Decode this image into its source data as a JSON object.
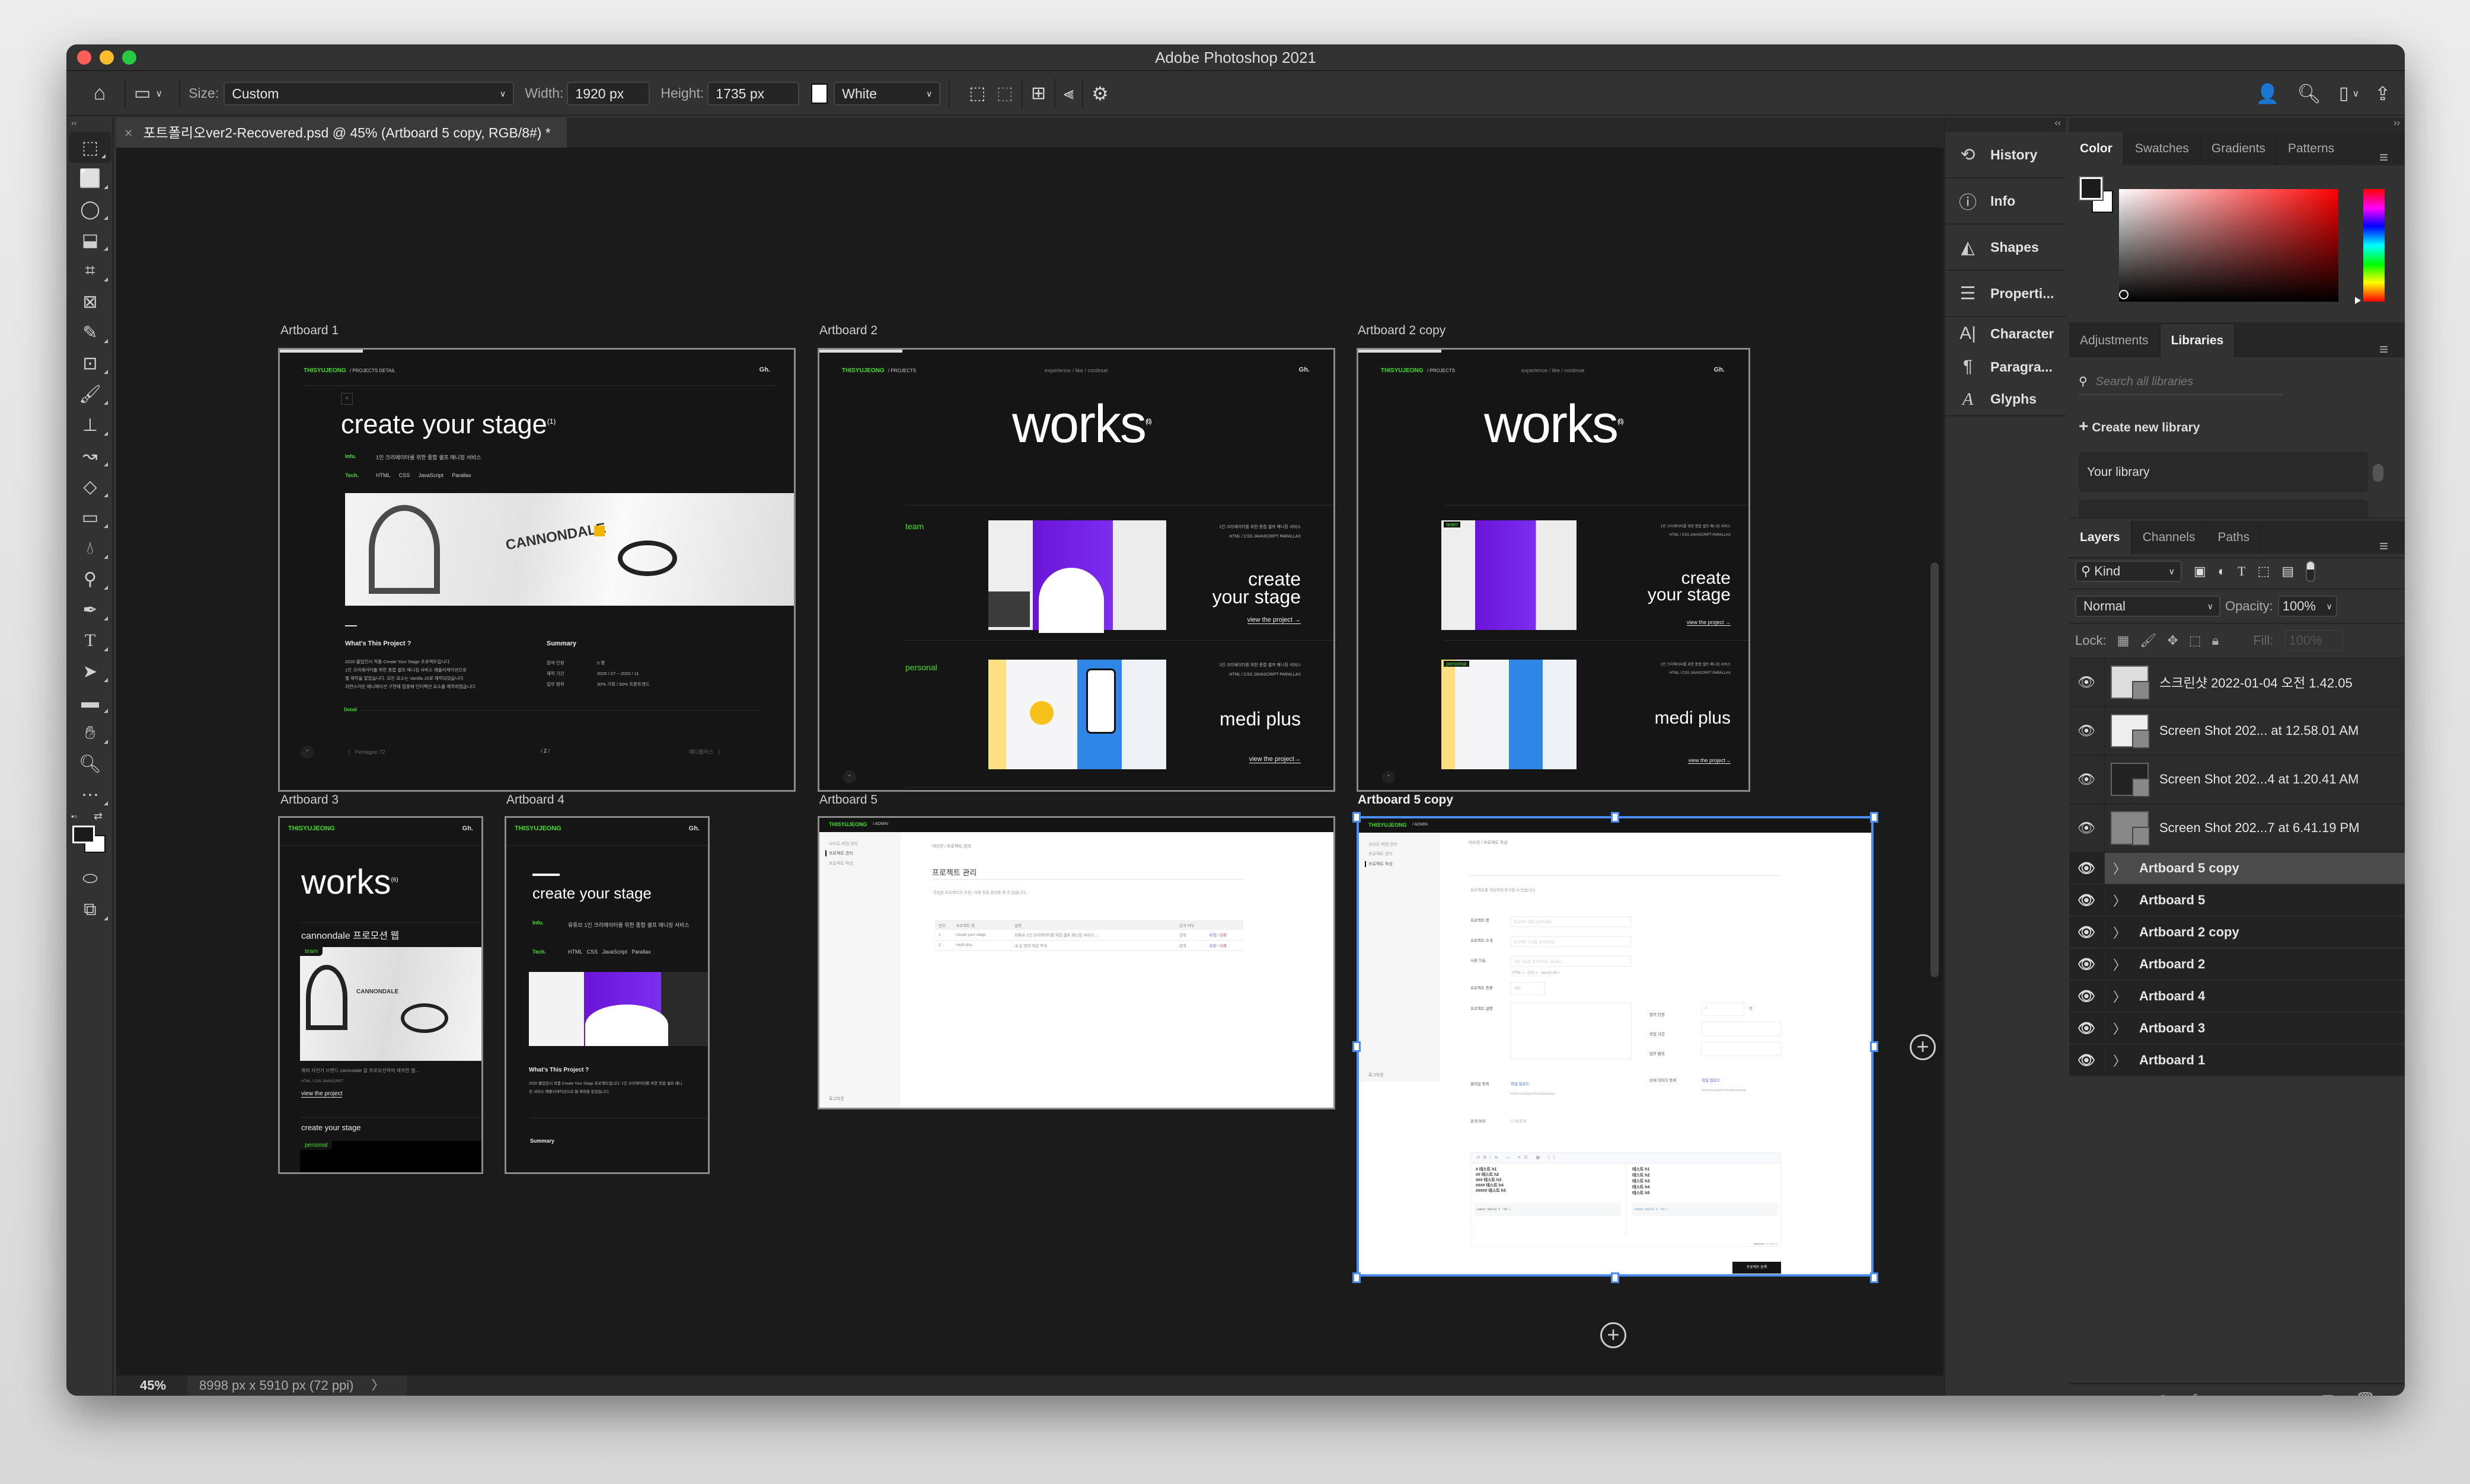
{
  "window": {
    "title": "Adobe Photoshop 2021"
  },
  "options_bar": {
    "size_label": "Size:",
    "size_value": "Custom",
    "width_label": "Width:",
    "width_value": "1920 px",
    "height_label": "Height:",
    "height_value": "1735 px",
    "bg_value": "White"
  },
  "document_tab": {
    "title": "포트폴리오ver2-Recovered.psd @ 45% (Artboard 5 copy, RGB/8#) *"
  },
  "status_bar": {
    "zoom": "45%",
    "doc_info": "8998 px x 5910 px (72 ppi)"
  },
  "tools": [
    "artboard",
    "rectangular-marquee",
    "lasso",
    "object-selection",
    "crop",
    "frame",
    "eyedropper",
    "spot-healing",
    "brush",
    "clone-stamp",
    "history-brush",
    "eraser",
    "gradient",
    "blur",
    "dodge",
    "pen",
    "type",
    "path-selection",
    "rectangle",
    "hand",
    "zoom",
    "more"
  ],
  "artboards": {
    "ab1": {
      "label": "Artboard 1",
      "brand": "THISYUJEONG",
      "crumb": "/  PROJECTS DETAIL",
      "gh": "Gh.",
      "title": "create your stage",
      "title_sup": "(1)",
      "info_label": "Info.",
      "info_text": "1인 크리에이터를 위한 종합 셀프 매니징 서비스",
      "tech_label": "Tech.",
      "tech": [
        "HTML",
        "CSS",
        "JavaScript",
        "Parallax"
      ],
      "what_title": "What's This Project ?",
      "what_lines": [
        "2020 졸업전시 작품 Create Your Stage 프로젝트입니다.",
        "1인 크리에이터를 위한 종합 셀프 매니징 서비스 애플리케이션으로",
        "웹 제작을 맡았습니다. 모든 요소는 Vanilla JS로 제작되었습니다.",
        "자연스러운 애니메이션 구현에 집중해 인터랙션 요소를 제작하였습니다."
      ],
      "summary_title": "Summary",
      "summary": [
        {
          "k": "참여 인원",
          "v": "5 명"
        },
        {
          "k": "제작 기간",
          "v": "2020 / 07 ~ 2020 / 11"
        },
        {
          "k": "업무 범위",
          "v": "30% 기획 / 50% 프론트엔드"
        }
      ],
      "detail": "Detail",
      "prev": "Pentagon 72",
      "page": "2",
      "next": "메디플러스"
    },
    "ab2": {
      "label": "Artboard 2",
      "brand": "THISYUJEONG",
      "crumb": "/  PROJECTS",
      "nav": "experience / like / continue",
      "gh": "Gh.",
      "title": "works",
      "title_sup": "(6)",
      "projects": [
        {
          "tag": "team",
          "desc": "1인 크리에이터를 위한 종합 셀프 매니징 서비스",
          "tech": "HTML / CSS   JAVASCRIPT   PARALLAX",
          "name1": "create",
          "name2": "your stage",
          "link": "view the project →"
        },
        {
          "tag": "personal",
          "desc": "1인 크리에이터를 위한 종합 셀프 매니징 서비스",
          "tech": "HTML / CSS   JAVASCRIPT   PARALLAX",
          "name1": "medi plus",
          "name2": "",
          "link": "view the project→"
        }
      ]
    },
    "ab2copy": {
      "label": "Artboard 2 copy"
    },
    "ab3": {
      "label": "Artboard 3",
      "brand": "THISYUJEONG",
      "gh": "Gh.",
      "title": "works",
      "title_sup": "(6)",
      "project1": "cannondale 프로모션 웹",
      "tag1": "team",
      "desc1": "해외 자전거 브랜드 cannodale 을 프로모션하여 제작한 웹...",
      "tech1": "HTML / CSS   JAVASCRIPT",
      "link1": "view the project",
      "project2": "create your stage",
      "tag2": "personal"
    },
    "ab4": {
      "label": "Artboard 4",
      "brand": "THISYUJEONG",
      "gh": "Gh.",
      "title": "create your stage",
      "info_label": "Info.",
      "info_text": "유튜브 1인 크리에이터를 위한 종합 셀프 매니징 서비스",
      "tech_label": "Tech.",
      "tech": "HTML   CSS   JavaScript   Parallax",
      "what_title": "What's This Project ?",
      "what_text": "2020 졸업전시 작품 Create Your Stage 프로젝트입니다. 1인 크리에이터를 위한 종합 셀프 매니징 서비스 애플리케이션으로 웹 제작을 맡았습니다.",
      "summary_title": "Summary"
    },
    "ab5": {
      "label": "Artboard 5",
      "brand": "THISYUJEONG",
      "crumb": "/  ADMIN",
      "menu": [
        "사이트 버전 관리",
        "프로젝트 관리",
        "프로젝트 작성"
      ],
      "breadcrumb": "어드민 / 프로젝트 관리",
      "heading": "프로젝트 관리",
      "desc": "작성된 프로젝트의 수정 / 삭제 등을 관리를 할 수 있습니다.",
      "table_headers": [
        "번호",
        "프로젝트 명",
        "설명",
        "공개 여부",
        ""
      ],
      "rows": [
        {
          "no": "1",
          "name": "create your stage",
          "desc": "유튜브 1인 크리에이터를 위한 셀프 매니징 서비스 ...",
          "public": "공개",
          "edit": "수정",
          "del": "삭제"
        },
        {
          "no": "2",
          "name": "medi plus",
          "desc": "내 손 안의 작은 약국",
          "public": "공개",
          "edit": "수정",
          "del": "삭제"
        }
      ],
      "logout": "로그아웃"
    },
    "ab5copy": {
      "label": "Artboard 5 copy",
      "brand": "THISYUJEONG",
      "crumb": "/  ADMIN",
      "menu": [
        "사이트 버전 관리",
        "프로젝트 관리",
        "프로젝트 작성"
      ],
      "breadcrumb": "어드민 / 프로젝트 작성",
      "desc": "프로젝트를 작성하여 추가할 수 있습니다.",
      "fields": [
        {
          "label": "프로젝트 명",
          "placeholder": "프로젝트 명을 입력하세요."
        },
        {
          "label": "프로젝트 소개",
          "placeholder": "프로젝트 소개를 입력하세요."
        },
        {
          "label": "사용 기술",
          "placeholder": "사용 기술을 추가하세요. (Enter)"
        }
      ],
      "tech_tags": "HTML ×   CSS ×   JavaScript ×",
      "type_label": "프로젝트 종류",
      "type_value": "개인",
      "desc_label": "프로젝트 설명",
      "members_label": "참여 인원",
      "members_value": "1",
      "members_unit": "명",
      "period_label": "작업 기간",
      "scope_label": "업무 범위",
      "thumb_label": "썸네일 등록",
      "detail_img_label": "상세 이미지 등록",
      "upload": "파일 업로드",
      "file1": "team-cs-project-thumbnail.png",
      "file2": "team-cs-project-thumbnail.png",
      "public_label": "공개 여부",
      "public_value": "비공개",
      "md_lines": [
        "# 테스트 h1",
        "## 테스트 h2",
        "### 테스트 h3",
        "#### 테스트 h4",
        "##### 테스트 h5"
      ],
      "preview_lines": [
        "테스트 h1",
        "테스트 h2",
        "테스트 h3",
        "테스트 h4",
        "테스트 h5"
      ],
      "code": "const hello = 'hi';",
      "mode_md": "Markdown",
      "mode_wysiwyg": "WYSIWYG",
      "submit": "프로젝트 등록",
      "logout": "로그아웃"
    }
  },
  "dock": {
    "items": [
      {
        "label": "History",
        "icon": "history-icon"
      },
      {
        "label": "Info",
        "icon": "info-icon"
      },
      {
        "label": "Shapes",
        "icon": "shapes-icon"
      },
      {
        "label": "Properti...",
        "icon": "properties-icon"
      },
      {
        "label": "Character",
        "icon": "character-icon"
      },
      {
        "label": "Paragra...",
        "icon": "paragraph-icon"
      },
      {
        "label": "Glyphs",
        "icon": "glyphs-icon"
      }
    ]
  },
  "color_panel": {
    "tabs": [
      "Color",
      "Swatches",
      "Gradients",
      "Patterns"
    ],
    "active": "Color",
    "hue_color": "#ff0000"
  },
  "libraries_panel": {
    "tabs": [
      "Adjustments",
      "Libraries"
    ],
    "active": "Libraries",
    "search_placeholder": "Search all libraries",
    "create": "Create new library",
    "library_item": "Your library"
  },
  "layers_panel": {
    "tabs": [
      "Layers",
      "Channels",
      "Paths"
    ],
    "active": "Layers",
    "filter_kind": "Kind",
    "blend_mode": "Normal",
    "opacity_label": "Opacity:",
    "opacity": "100%",
    "lock_label": "Lock:",
    "fill_label": "Fill:",
    "fill": "100%",
    "image_layers": [
      "스크린샷 2022-01-04 오전 1.42.05",
      "Screen Shot 202... at 12.58.01 AM",
      "Screen Shot 202...4 at 1.20.41 AM",
      "Screen Shot 202...7 at 6.41.19 PM"
    ],
    "artboard_layers": [
      "Artboard 5 copy",
      "Artboard 5",
      "Artboard 2 copy",
      "Artboard 2",
      "Artboard 4",
      "Artboard 3",
      "Artboard 1"
    ],
    "selected": "Artboard 5 copy"
  },
  "colors": {
    "accent_green": "#3fe01c",
    "selection_blue": "#4b8cf0",
    "purple": "#6a14d8",
    "blue": "#2f86e6"
  }
}
